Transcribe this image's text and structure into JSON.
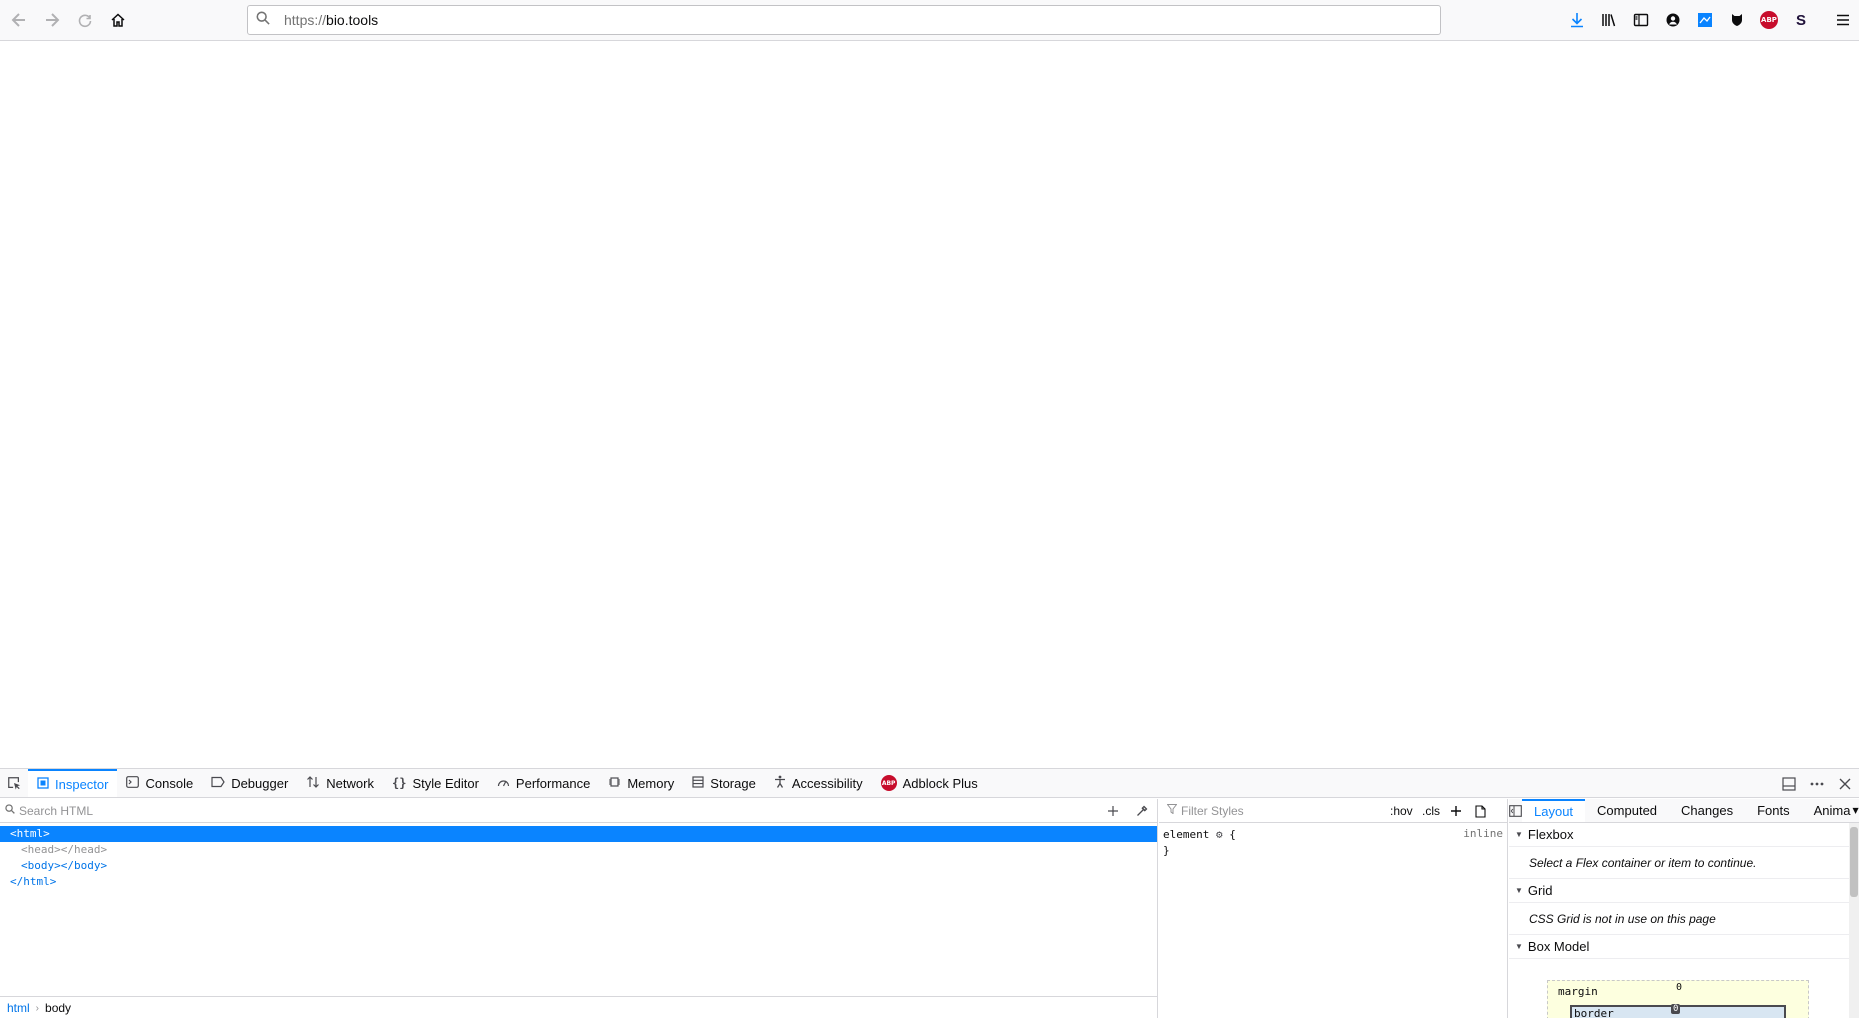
{
  "browser": {
    "url_scheme": "https://",
    "url_host": "bio.tools"
  },
  "devtools": {
    "tabs": [
      {
        "label": "Inspector"
      },
      {
        "label": "Console"
      },
      {
        "label": "Debugger"
      },
      {
        "label": "Network"
      },
      {
        "label": "Style Editor"
      },
      {
        "label": "Performance"
      },
      {
        "label": "Memory"
      },
      {
        "label": "Storage"
      },
      {
        "label": "Accessibility"
      },
      {
        "label": "Adblock Plus"
      }
    ],
    "abp_badge": "ABP",
    "markup": {
      "search_placeholder": "Search HTML",
      "nodes": {
        "html_open": "<html>",
        "head": "<head></head>",
        "body": "<body></body>",
        "html_close": "</html>"
      },
      "breadcrumbs": [
        "html",
        "body"
      ]
    },
    "rules": {
      "filter_placeholder": "Filter Styles",
      "hov": ":hov",
      "cls": ".cls",
      "selector": "element",
      "open_brace": "{",
      "close_brace": "}",
      "source": "inline"
    },
    "sidebar": {
      "tabs": [
        "Layout",
        "Computed",
        "Changes",
        "Fonts",
        "Anima"
      ],
      "flexbox_title": "Flexbox",
      "flexbox_msg": "Select a Flex container or item to continue.",
      "grid_title": "Grid",
      "grid_msg": "CSS Grid is not in use on this page",
      "boxmodel_title": "Box Model",
      "margin_label": "margin",
      "margin_value": "0",
      "border_label": "border",
      "border_value": "0"
    }
  },
  "toolbar_abp_badge": "ABP",
  "toolbar_s": "S"
}
